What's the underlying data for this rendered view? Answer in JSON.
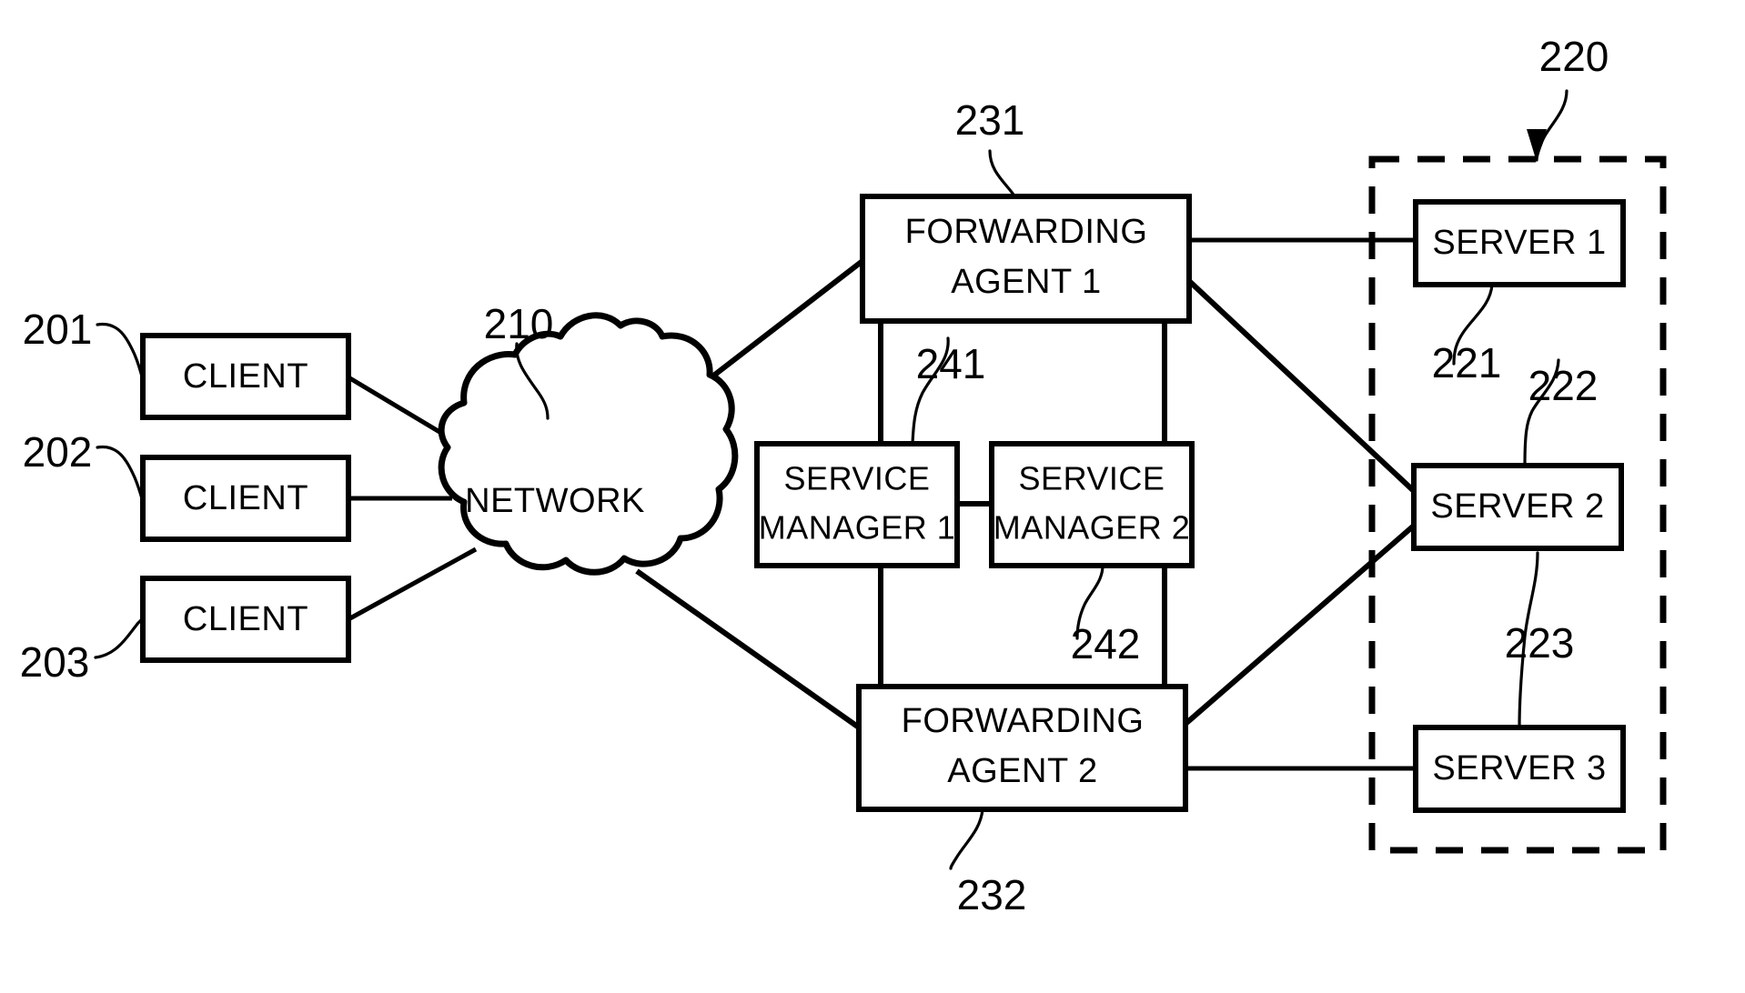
{
  "figure": {
    "type": "patent-network-architecture-diagram",
    "background_color": "#ffffff",
    "line_color": "#000000"
  },
  "clients": [
    {
      "ref": "201",
      "label": "CLIENT"
    },
    {
      "ref": "202",
      "label": "CLIENT"
    },
    {
      "ref": "203",
      "label": "CLIENT"
    }
  ],
  "network": {
    "ref": "210",
    "label": "NETWORK"
  },
  "forwarding_agents": [
    {
      "ref": "231",
      "line1": "FORWARDING",
      "line2": "AGENT 1"
    },
    {
      "ref": "232",
      "line1": "FORWARDING",
      "line2": "AGENT 2"
    }
  ],
  "service_managers": [
    {
      "ref": "241",
      "line1": "SERVICE",
      "line2": "MANAGER 1"
    },
    {
      "ref": "242",
      "line1": "SERVICE",
      "line2": "MANAGER 2"
    }
  ],
  "server_group": {
    "ref": "220",
    "servers": [
      {
        "ref": "221",
        "label": "SERVER 1"
      },
      {
        "ref": "222",
        "label": "SERVER 2"
      },
      {
        "ref": "223",
        "label": "SERVER 3"
      }
    ]
  }
}
